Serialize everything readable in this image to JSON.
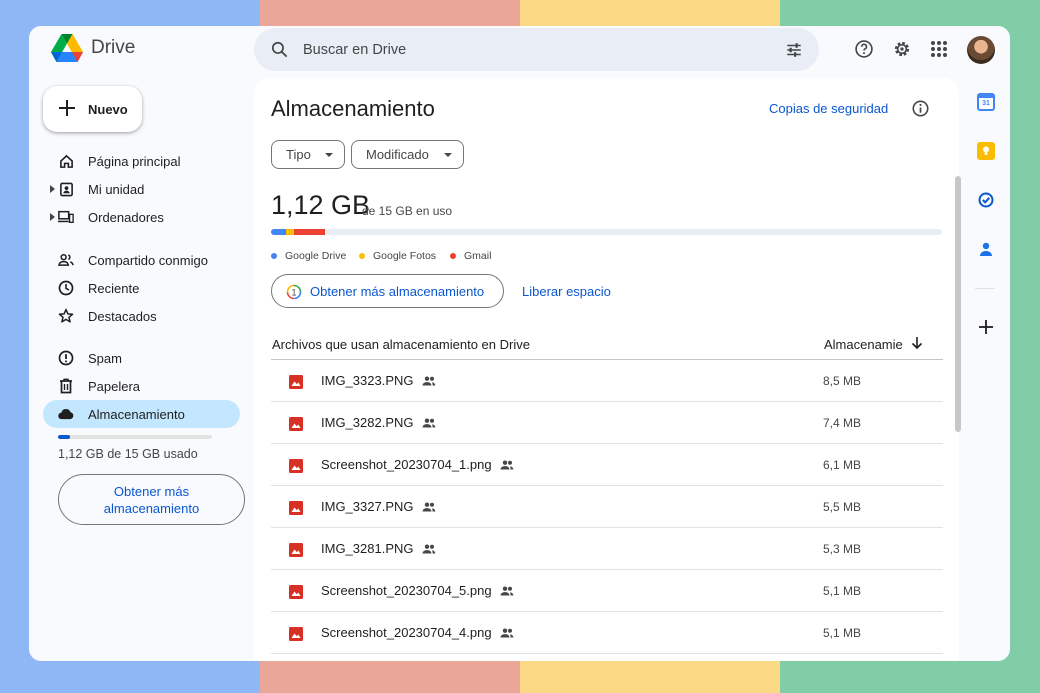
{
  "app": {
    "name": "Drive"
  },
  "search": {
    "placeholder": "Buscar en Drive"
  },
  "sidebar": {
    "new_label": "Nuevo",
    "items": [
      {
        "label": "Página principal",
        "icon": "home-icon"
      },
      {
        "label": "Mi unidad",
        "icon": "my-drive-icon"
      },
      {
        "label": "Ordenadores",
        "icon": "computers-icon"
      },
      {
        "label": "Compartido conmigo",
        "icon": "shared-icon"
      },
      {
        "label": "Reciente",
        "icon": "clock-icon"
      },
      {
        "label": "Destacados",
        "icon": "star-icon"
      },
      {
        "label": "Spam",
        "icon": "spam-icon"
      },
      {
        "label": "Papelera",
        "icon": "trash-icon"
      },
      {
        "label": "Almacenamiento",
        "icon": "cloud-icon"
      }
    ],
    "quota_fraction": 0.075,
    "quota_text": "1,12 GB de 15 GB usado",
    "get_more": "Obtener más almacenamiento"
  },
  "main": {
    "title": "Almacenamiento",
    "backup_link": "Copias de seguridad",
    "filters": [
      "Tipo",
      "Modificado"
    ],
    "used_amount": "1,12 GB",
    "used_of": "de 15 GB en uso",
    "usage": [
      {
        "name": "Google Drive",
        "color": "#4285f4",
        "fraction": 0.023
      },
      {
        "name": "Google Fotos",
        "color": "#fbbc04",
        "fraction": 0.012
      },
      {
        "name": "Gmail",
        "color": "#ea4335",
        "fraction": 0.045
      }
    ],
    "upgrade_btn": "Obtener más almacenamiento",
    "free_link": "Liberar espacio",
    "table": {
      "col_name": "Archivos que usan almacenamiento en Drive",
      "col_size": "Almacenamiento",
      "rows": [
        {
          "name": "IMG_3323.PNG",
          "size": "8,5 MB"
        },
        {
          "name": "IMG_3282.PNG",
          "size": "7,4 MB"
        },
        {
          "name": "Screenshot_20230704_1.png",
          "size": "6,1 MB"
        },
        {
          "name": "IMG_3327.PNG",
          "size": "5,5 MB"
        },
        {
          "name": "IMG_3281.PNG",
          "size": "5,3 MB"
        },
        {
          "name": "Screenshot_20230704_5.png",
          "size": "5,1 MB"
        },
        {
          "name": "Screenshot_20230704_4.png",
          "size": "5,1 MB"
        }
      ]
    }
  },
  "rail": {
    "calendar_day": "31",
    "icons": [
      "calendar-icon",
      "keep-icon",
      "tasks-icon",
      "contacts-icon",
      "add-icon"
    ]
  }
}
